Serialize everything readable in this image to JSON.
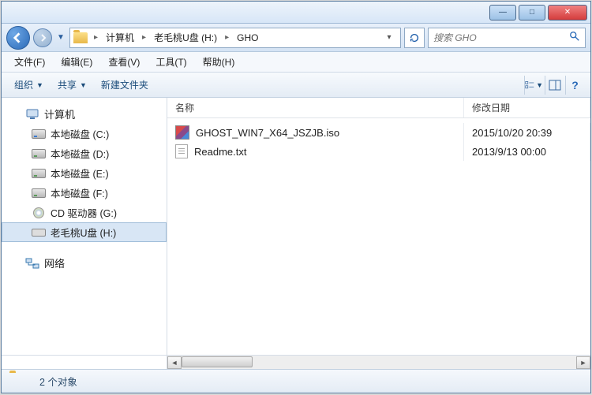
{
  "window_controls": {
    "min": "—",
    "max": "□",
    "close": "✕"
  },
  "breadcrumb": {
    "root_icon": "folder",
    "items": [
      "计算机",
      "老毛桃U盘 (H:)",
      "GHO"
    ]
  },
  "search": {
    "placeholder": "搜索 GHO"
  },
  "menubar": [
    {
      "label": "文件(F)"
    },
    {
      "label": "编辑(E)"
    },
    {
      "label": "查看(V)"
    },
    {
      "label": "工具(T)"
    },
    {
      "label": "帮助(H)"
    }
  ],
  "toolbar": {
    "organize": "组织",
    "share": "共享",
    "new_folder": "新建文件夹"
  },
  "sidebar": {
    "computer": {
      "label": "计算机",
      "children": [
        {
          "label": "本地磁盘 (C:)",
          "icon": "disk-win"
        },
        {
          "label": "本地磁盘 (D:)",
          "icon": "disk"
        },
        {
          "label": "本地磁盘 (E:)",
          "icon": "disk"
        },
        {
          "label": "本地磁盘 (F:)",
          "icon": "disk"
        },
        {
          "label": "CD 驱动器 (G:)",
          "icon": "cd"
        },
        {
          "label": "老毛桃U盘 (H:)",
          "icon": "usb",
          "selected": true
        }
      ]
    },
    "network": {
      "label": "网络"
    }
  },
  "columns": {
    "name": "名称",
    "date": "修改日期"
  },
  "files": [
    {
      "name": "GHOST_WIN7_X64_JSZJB.iso",
      "date": "2015/10/20 20:39",
      "icon": "iso"
    },
    {
      "name": "Readme.txt",
      "date": "2013/9/13 00:00",
      "icon": "txt"
    }
  ],
  "status": {
    "text": "2 个对象"
  }
}
